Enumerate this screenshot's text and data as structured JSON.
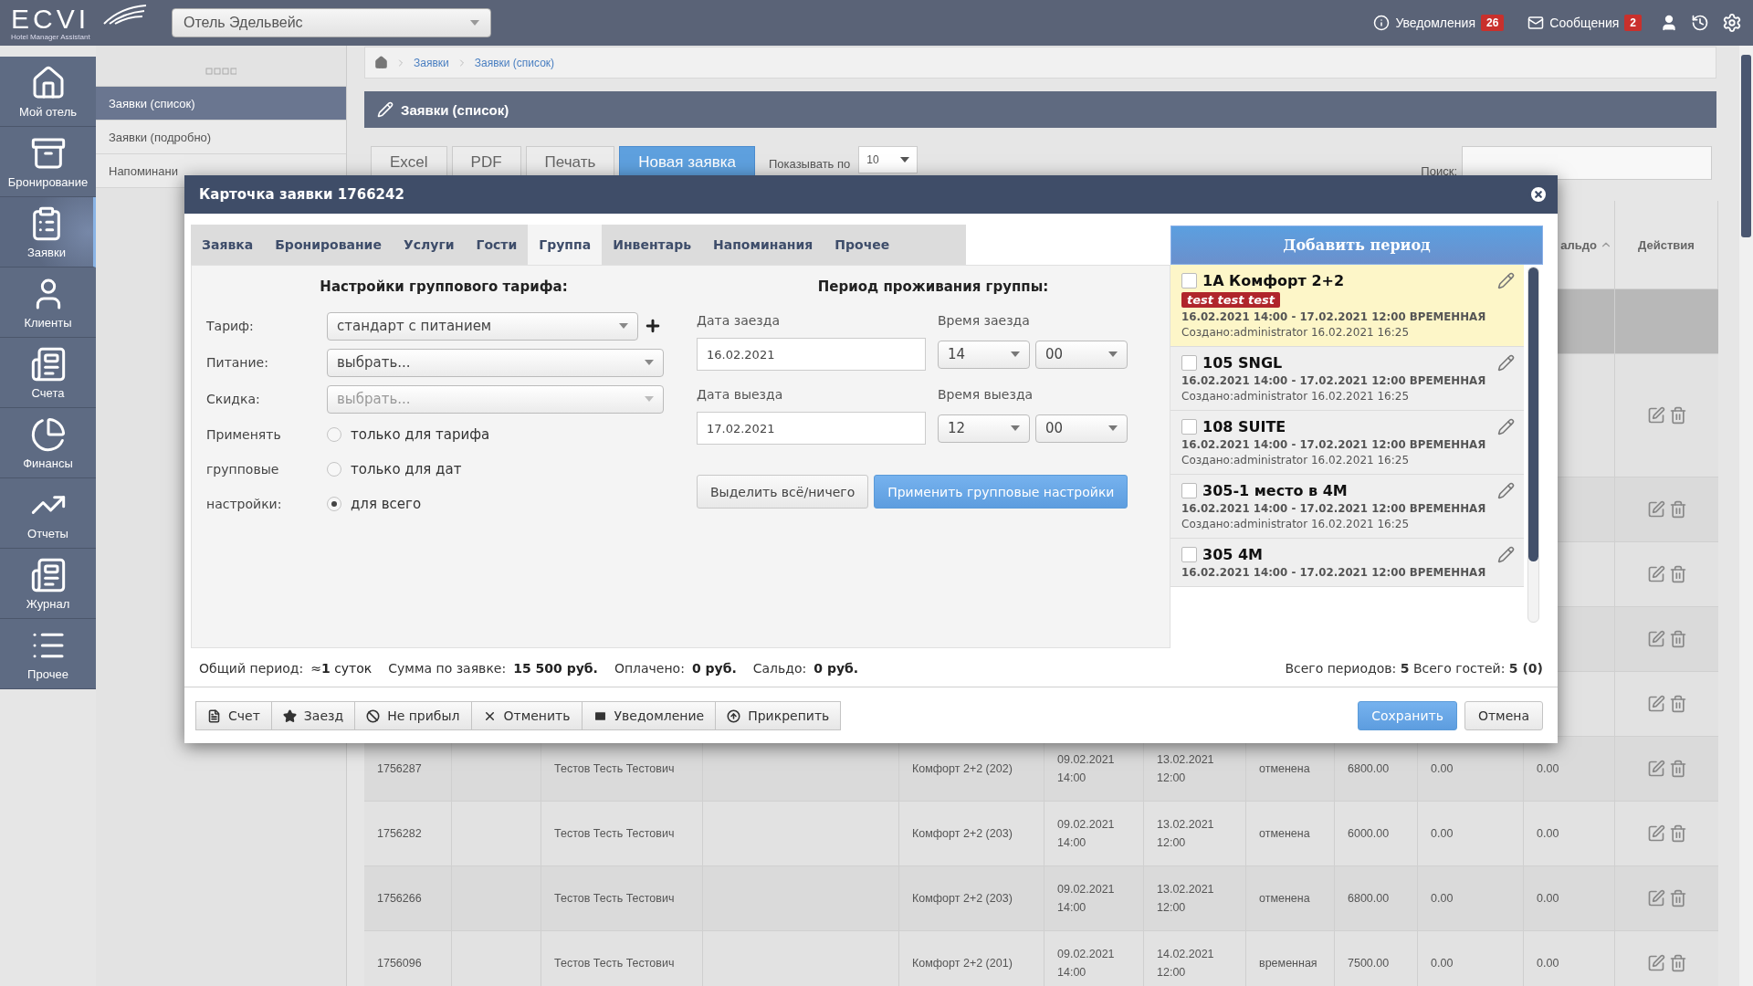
{
  "topbar": {
    "logo": {
      "name": "ECVI",
      "tagline": "Hotel Manager Assistant"
    },
    "hotel_select": {
      "value": "Отель Эдельвейс"
    },
    "notifications": {
      "label": "Уведомления",
      "count": "26"
    },
    "messages": {
      "label": "Сообщения",
      "count": "2"
    }
  },
  "nav": [
    {
      "label": "Мой отель",
      "selected": false
    },
    {
      "label": "Бронирование",
      "selected": false
    },
    {
      "label": "Заявки",
      "selected": true
    },
    {
      "label": "Клиенты",
      "selected": false
    },
    {
      "label": "Счета",
      "selected": false
    },
    {
      "label": "Финансы",
      "selected": false
    },
    {
      "label": "Отчеты",
      "selected": false
    },
    {
      "label": "Журнал",
      "selected": false
    },
    {
      "label": "Прочее",
      "selected": false
    }
  ],
  "submenu": [
    {
      "label": "Заявки (список)",
      "selected": true
    },
    {
      "label": "Заявки (подробно)",
      "selected": false
    },
    {
      "label": "Напоминани",
      "selected": false
    }
  ],
  "breadcrumbs": [
    "Заявки",
    "Заявки (список)"
  ],
  "page_title": "Заявки (список)",
  "toolbar": {
    "buttons": [
      {
        "label": "Excel",
        "primary": false
      },
      {
        "label": "PDF",
        "primary": false
      },
      {
        "label": "Печать",
        "primary": false
      },
      {
        "label": "Новая заявка",
        "primary": true
      }
    ],
    "page_size_label": "Показывать по",
    "page_size": "10",
    "search_label": "Поиск:"
  },
  "table": {
    "columns": [
      {
        "label": "альдо",
        "sorted": true
      },
      {
        "label": "Действия",
        "sorted": false
      }
    ],
    "rows": [
      {
        "selected": true,
        "actions": false,
        "tall": false
      },
      {
        "selected": false,
        "actions": true,
        "tall": true
      },
      {
        "selected": false,
        "actions": true,
        "tall": false
      },
      {
        "selected": false,
        "actions": true,
        "tall": false
      },
      {
        "selected": false,
        "actions": true,
        "tall": false
      },
      {
        "selected": false,
        "actions": true,
        "tall": false
      },
      {
        "selected": false,
        "actions": true,
        "tall": false,
        "cells": {
          "id": "1756287",
          "guest": "Тестов Тесть Тестович",
          "room": "Комфорт 2+2 (202)",
          "arrival": "09.02.2021 14:00",
          "departure": "13.02.2021 12:00",
          "status": "отменена",
          "amount": "6800.00",
          "paid": "0.00",
          "saldo": "0.00"
        }
      },
      {
        "selected": false,
        "actions": true,
        "tall": false,
        "cells": {
          "id": "1756282",
          "guest": "Тестов Тесть Тестович",
          "room": "Комфорт 2+2 (203)",
          "arrival": "09.02.2021 14:00",
          "departure": "13.02.2021 12:00",
          "status": "отменена",
          "amount": "6000.00",
          "paid": "0.00",
          "saldo": "0.00"
        }
      },
      {
        "selected": false,
        "actions": true,
        "tall": false,
        "cells": {
          "id": "1756266",
          "guest": "Тестов Тесть Тестович",
          "room": "Комфорт 2+2 (203)",
          "arrival": "09.02.2021 14:00",
          "departure": "13.02.2021 12:00",
          "status": "отменена",
          "amount": "6800.00",
          "paid": "0.00",
          "saldo": "0.00"
        }
      },
      {
        "selected": false,
        "actions": true,
        "tall": false,
        "cells": {
          "id": "1756096",
          "guest": "Тестов Тесть Тестович",
          "room": "Комфорт 2+2 (201)",
          "arrival": "09.02.2021 14:00",
          "departure": "14.02.2021 12:00",
          "status": "временная",
          "amount": "7500.00",
          "paid": "0.00",
          "saldo": "0.00"
        }
      }
    ]
  },
  "modal": {
    "title": "Карточка заявки 1766242",
    "tabs": [
      {
        "label": "Заявка",
        "selected": false
      },
      {
        "label": "Бронирование",
        "selected": false
      },
      {
        "label": "Услуги",
        "selected": false
      },
      {
        "label": "Гости",
        "selected": false
      },
      {
        "label": "Группа",
        "selected": true
      },
      {
        "label": "Инвентарь",
        "selected": false
      },
      {
        "label": "Напоминания",
        "selected": false
      },
      {
        "label": "Прочее",
        "selected": false
      }
    ],
    "tariff_settings": {
      "heading": "Настройки группового тарифа:",
      "fields": [
        {
          "label": "Тариф:",
          "value": "стандарт с питанием",
          "disabled": false,
          "add_button": true
        },
        {
          "label": "Питание:",
          "value": "выбрать...",
          "disabled": false,
          "add_button": false
        },
        {
          "label": "Скидка:",
          "placeholder": "выбрать...",
          "disabled": true,
          "add_button": false
        }
      ],
      "apply": [
        {
          "label": "Применять",
          "option": "только для тарифа",
          "selected": false
        },
        {
          "label": "групповые",
          "option": "только для дат",
          "selected": false
        },
        {
          "label": "настройки:",
          "option": "для всего",
          "selected": true
        }
      ]
    },
    "period": {
      "heading": "Период проживания группы:",
      "rows": [
        {
          "date_label": "Дата заезда",
          "date": "16.02.2021",
          "time_label": "Время заезда",
          "hour": "14",
          "minute": "00"
        },
        {
          "date_label": "Дата выезда",
          "date": "17.02.2021",
          "time_label": "Время выезда",
          "hour": "12",
          "minute": "00"
        }
      ],
      "buttons": [
        {
          "label": "Выделить всё/ничего",
          "primary": false
        },
        {
          "label": "Применить групповые настройки",
          "primary": true
        }
      ]
    },
    "periods": {
      "add_button": "Добавить период",
      "items": [
        {
          "title": "1A Комфорт 2+2",
          "highlighted": true,
          "checked": false,
          "tag": "test test test",
          "dates": "16.02.2021 14:00 - 17.02.2021 12:00 ВРЕМЕННАЯ",
          "created": "Создано:administrator 16.02.2021 16:25"
        },
        {
          "title": "105 SNGL",
          "highlighted": false,
          "checked": false,
          "dates": "16.02.2021 14:00 - 17.02.2021 12:00 ВРЕМЕННАЯ",
          "created": "Создано:administrator 16.02.2021 16:25"
        },
        {
          "title": "108 SUITE",
          "highlighted": false,
          "checked": false,
          "dates": "16.02.2021 14:00 - 17.02.2021 12:00 ВРЕМЕННАЯ",
          "created": "Создано:administrator 16.02.2021 16:25"
        },
        {
          "title": "305-1 место в 4М",
          "highlighted": false,
          "checked": false,
          "dates": "16.02.2021 14:00 - 17.02.2021 12:00 ВРЕМЕННАЯ",
          "created": "Создано:administrator 16.02.2021 16:25"
        },
        {
          "title": "305 4М",
          "highlighted": false,
          "checked": false,
          "dates": "16.02.2021 14:00 - 17.02.2021 12:00 ВРЕМЕННАЯ"
        }
      ]
    },
    "summary": {
      "period": {
        "label": "Общий период:",
        "value": "≈**1** суток"
      },
      "amounts": [
        {
          "label": "Сумма по заявке:",
          "value": "15 500 руб."
        },
        {
          "label": "Оплачено:",
          "value": "0 руб."
        },
        {
          "label": "Сальдо:",
          "value": "0 руб."
        }
      ],
      "totals": "Всего периодов: **5** Всего гостей: **5 (0)**"
    },
    "actions": [
      {
        "label": "Счет"
      },
      {
        "label": "Заезд"
      },
      {
        "label": "Не прибыл"
      },
      {
        "label": "Отменить"
      },
      {
        "label": "Уведомление"
      },
      {
        "label": "Прикрепить"
      }
    ],
    "save": "Сохранить",
    "cancel": "Отмена"
  }
}
